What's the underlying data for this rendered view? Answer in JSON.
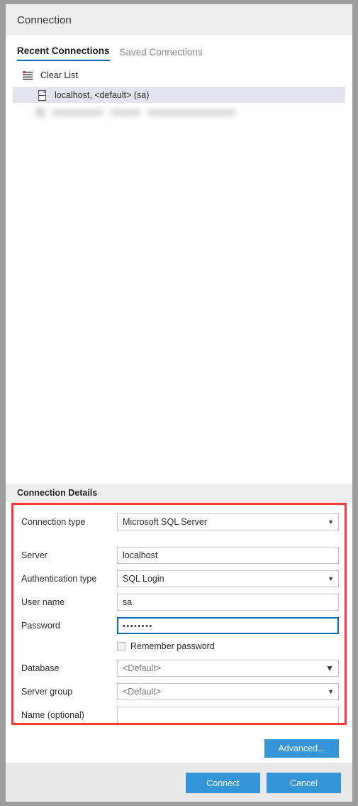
{
  "window": {
    "title": "Connection"
  },
  "tabs": [
    {
      "label": "Recent Connections",
      "active": true
    },
    {
      "label": "Saved Connections",
      "active": false
    }
  ],
  "recent_list": {
    "clear_list": {
      "label": "Clear List",
      "icon": "clear-list-icon"
    },
    "items": [
      {
        "label": "localhost, <default> (sa)",
        "icon": "server-icon",
        "selected": true
      },
      {
        "label": "",
        "icon": "server-icon",
        "selected": false,
        "redacted": true
      }
    ]
  },
  "details": {
    "header": "Connection Details",
    "fields": [
      {
        "label": "Connection type",
        "value": "Microsoft SQL Server",
        "type": "select",
        "caret": "small"
      },
      {
        "label": "Server",
        "value": "localhost",
        "type": "text"
      },
      {
        "label": "Authentication type",
        "value": "SQL Login",
        "type": "select",
        "caret": "small"
      },
      {
        "label": "User name",
        "value": "sa",
        "type": "text"
      },
      {
        "label": "Password",
        "value": "••••••••",
        "type": "password",
        "focused": true
      },
      {
        "label": "Database",
        "value": "<Default>",
        "type": "select",
        "caret": "big",
        "placeholder_style": true
      },
      {
        "label": "Server group",
        "value": "<Default>",
        "type": "select",
        "caret": "small",
        "placeholder_style": true
      },
      {
        "label": "Name (optional)",
        "value": "",
        "type": "text"
      }
    ],
    "remember_password": {
      "label": "Remember password",
      "checked": false
    },
    "advanced_button": "Advanced..."
  },
  "footer": {
    "connect_button": "Connect",
    "cancel_button": "Cancel"
  },
  "colors": {
    "accent_blue": "#3496d8",
    "tab_underline": "#0d6cb9",
    "highlight_red": "#f8393c",
    "focus_border": "#0d6cb9",
    "selected_row": "#e3e3ef",
    "header_bg": "#eeeeee",
    "window_chrome": "#9d9d9d"
  }
}
